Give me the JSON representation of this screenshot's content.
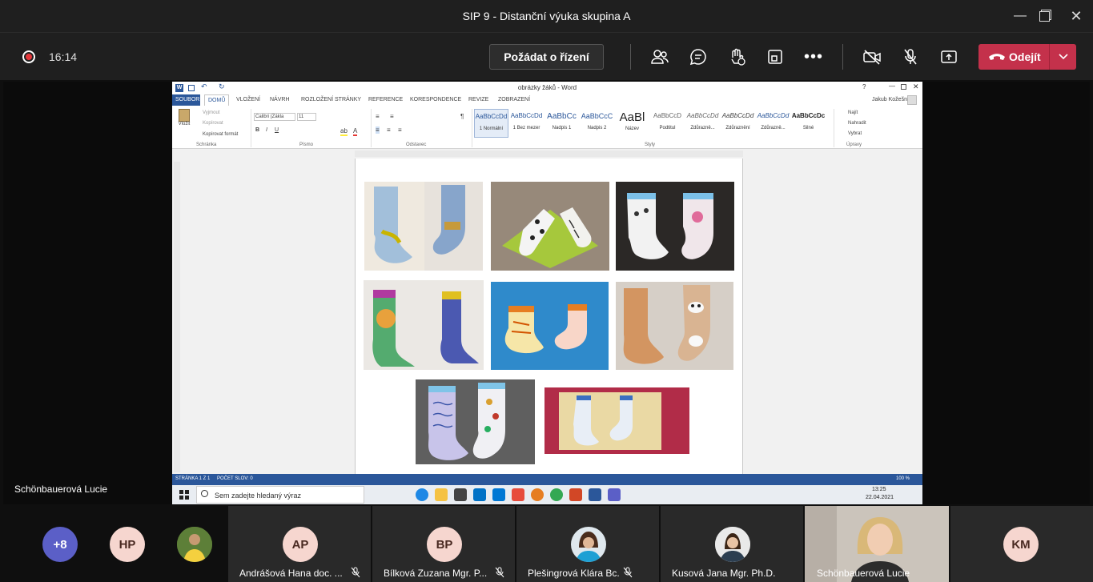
{
  "window": {
    "title": "SIP 9 - Distanční výuka skupina A"
  },
  "toolbar": {
    "timer": "16:14",
    "request_control_label": "Požádat o řízení",
    "leave_label": "Odejít"
  },
  "presenter": {
    "name": "Schönbauerová Lucie"
  },
  "word": {
    "title": "obrázky žáků - Word",
    "user": "Jakub Kožešník",
    "tabs": [
      "SOUBOR",
      "DOMŮ",
      "VLOŽENÍ",
      "NÁVRH",
      "ROZLOŽENÍ STRÁNKY",
      "REFERENCE",
      "KORESPONDENCE",
      "REVIZE",
      "ZOBRAZENÍ"
    ],
    "clipboard": {
      "paste": "Vložit",
      "cut": "Vyjmout",
      "copy": "Kopírovat",
      "format_painter": "Kopírovat formát",
      "group": "Schránka"
    },
    "font": {
      "name": "Calibri (Zákla",
      "size": "11",
      "group": "Písmo"
    },
    "paragraph_group": "Odstavec",
    "styles_group": "Styly",
    "editing": {
      "find": "Najít",
      "replace": "Nahradit",
      "select": "Vybrat",
      "group": "Úpravy"
    },
    "styles": [
      {
        "sample": "AaBbCcDd",
        "name": "1 Normální"
      },
      {
        "sample": "AaBbCcDd",
        "name": "1 Bez mezer"
      },
      {
        "sample": "AaBbCc",
        "name": "Nadpis 1"
      },
      {
        "sample": "AaBbCcC",
        "name": "Nadpis 2"
      },
      {
        "sample": "AaBl",
        "name": "Název"
      },
      {
        "sample": "AaBbCcD",
        "name": "Podtitul"
      },
      {
        "sample": "AaBbCcDd",
        "name": "Zdůrazně..."
      },
      {
        "sample": "AaBbCcDd",
        "name": "Zdůraznění"
      },
      {
        "sample": "AaBbCcDd",
        "name": "Zdůrazně..."
      },
      {
        "sample": "AaBbCcDc",
        "name": "Silné"
      }
    ],
    "status": {
      "page": "STRÁNKA 1 Z 1",
      "words": "POČET SLOV: 0",
      "zoom": "100 %"
    }
  },
  "taskbar": {
    "search_placeholder": "Sem zadejte hledaný výraz",
    "time": "13:25",
    "date": "22.04.2021"
  },
  "participants": [
    {
      "initials": "+8",
      "color": "#5b5fc7"
    },
    {
      "initials": "HP",
      "color": "#f6d6cf"
    },
    {
      "initials": "AP",
      "name": "Andrášová Hana doc. ...",
      "color": "#f6d6cf"
    },
    {
      "initials": "BP",
      "name": "Bílková Zuzana Mgr. P...",
      "color": "#f6d6cf"
    },
    {
      "name": "Plešingrová Klára Bc."
    },
    {
      "name": "Kusová Jana Mgr. Ph.D."
    },
    {
      "name": "Schönbauerová Lucie"
    },
    {
      "initials": "KM",
      "color": "#f6d6cf"
    }
  ]
}
